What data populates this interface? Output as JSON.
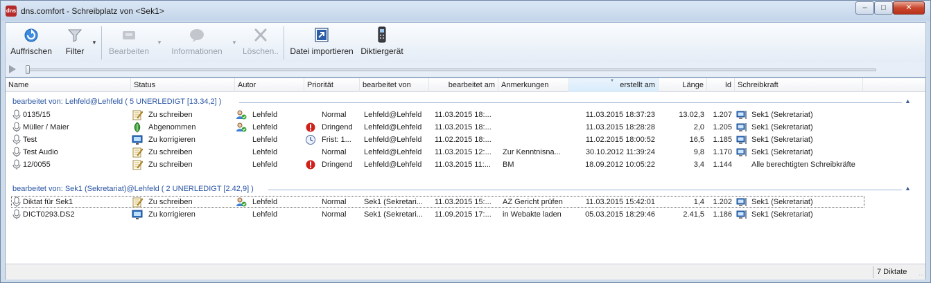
{
  "window": {
    "title": "dns.comfort - Schreibplatz von <Sek1>",
    "app_icon_text": "dns",
    "minimize": "–",
    "maximize": "□",
    "close": "✕"
  },
  "toolbar": {
    "refresh": "Auffrischen",
    "filter": "Filter",
    "edit": "Bearbeiten",
    "info": "Informationen",
    "delete": "Löschen..",
    "import": "Datei importieren",
    "recorder": "Diktiergerät",
    "dropdown_glyph": "▼"
  },
  "player": {
    "play_glyph": "▶"
  },
  "columns": {
    "name": "Name",
    "status": "Status",
    "autor": "Autor",
    "prioritaet": "Priorität",
    "bearbeitet_von": "bearbeitet von",
    "bearbeitet_am": "bearbeitet am",
    "anmerkungen": "Anmerkungen",
    "erstellt_am": "erstellt am",
    "laenge": "Länge",
    "id": "Id",
    "schreibkraft": "Schreibkraft"
  },
  "groups": [
    {
      "label": "bearbeitet von: Lehfeld@Lehfeld ( 5 UNERLEDIGT [13.34,2] )",
      "collapse_glyph": "▲",
      "rows": [
        {
          "name": "0135/15",
          "status": "Zu schreiben",
          "status_icon": "pencil-note-icon",
          "autor_icon": "user-check-icon",
          "autor": "Lehfeld",
          "prio_icon": "",
          "prioritaet": "Normal",
          "bearbeitet_von": "Lehfeld@Lehfeld",
          "bearbeitet_am": "11.03.2015 18:...",
          "anmerkungen": "",
          "erstellt_am": "11.03.2015 18:37:23",
          "laenge": "13.02,3",
          "id": "1.207",
          "schreibkraft_icon": "monitor-user-icon",
          "schreibkraft": "Sek1 (Sekretariat)"
        },
        {
          "name": "Müller / Maier",
          "status": "Abgenommen",
          "status_icon": "leaf-icon",
          "autor_icon": "user-check-icon",
          "autor": "Lehfeld",
          "prio_icon": "urgent-icon",
          "prioritaet": "Dringend",
          "bearbeitet_von": "Lehfeld@Lehfeld",
          "bearbeitet_am": "11.03.2015 18:...",
          "anmerkungen": "",
          "erstellt_am": "11.03.2015 18:28:28",
          "laenge": "2,0",
          "id": "1.205",
          "schreibkraft_icon": "monitor-user-icon",
          "schreibkraft": "Sek1 (Sekretariat)"
        },
        {
          "name": "Test",
          "status": "Zu korrigieren",
          "status_icon": "monitor-edit-icon",
          "autor_icon": "",
          "autor": "Lehfeld",
          "prio_icon": "clock-icon",
          "prioritaet": "Frist: 1...",
          "bearbeitet_von": "Lehfeld@Lehfeld",
          "bearbeitet_am": "11.02.2015 18:...",
          "anmerkungen": "",
          "erstellt_am": "11.02.2015 18:00:52",
          "laenge": "16,5",
          "id": "1.185",
          "schreibkraft_icon": "monitor-user-icon",
          "schreibkraft": "Sek1 (Sekretariat)"
        },
        {
          "name": "Test Audio",
          "status": "Zu schreiben",
          "status_icon": "pencil-note-icon",
          "autor_icon": "",
          "autor": "Lehfeld",
          "prio_icon": "",
          "prioritaet": "Normal",
          "bearbeitet_von": "Lehfeld@Lehfeld",
          "bearbeitet_am": "11.03.2015 12:...",
          "anmerkungen": "Zur Kenntnisna...",
          "erstellt_am": "30.10.2012 11:39:24",
          "laenge": "9,8",
          "id": "1.170",
          "schreibkraft_icon": "monitor-user-icon",
          "schreibkraft": "Sek1 (Sekretariat)"
        },
        {
          "name": "12/0055",
          "status": "Zu schreiben",
          "status_icon": "pencil-note-icon",
          "autor_icon": "",
          "autor": "Lehfeld",
          "prio_icon": "urgent-icon",
          "prioritaet": "Dringend",
          "bearbeitet_von": "Lehfeld@Lehfeld",
          "bearbeitet_am": "11.03.2015 11:...",
          "anmerkungen": "BM",
          "erstellt_am": "18.09.2012 10:05:22",
          "laenge": "3,4",
          "id": "1.144",
          "schreibkraft_icon": "",
          "schreibkraft": "Alle berechtigten Schreibkräfte"
        }
      ]
    },
    {
      "label": "bearbeitet von: Sek1 (Sekretariat)@Lehfeld ( 2 UNERLEDIGT [2.42,9] )",
      "collapse_glyph": "▲",
      "rows": [
        {
          "name": "Diktat für Sek1",
          "status": "Zu schreiben",
          "status_icon": "pencil-note-icon",
          "autor_icon": "user-check-icon",
          "autor": "Lehfeld",
          "prio_icon": "",
          "prioritaet": "Normal",
          "bearbeitet_von": "Sek1 (Sekretari...",
          "bearbeitet_am": "11.03.2015 15:...",
          "anmerkungen": "AZ Gericht prüfen",
          "erstellt_am": "11.03.2015 15:42:01",
          "laenge": "1,4",
          "id": "1.202",
          "schreibkraft_icon": "monitor-user-icon",
          "schreibkraft": "Sek1 (Sekretariat)",
          "focused": true
        },
        {
          "name": "DICT0293.DS2",
          "status": "Zu korrigieren",
          "status_icon": "monitor-edit-icon",
          "autor_icon": "",
          "autor": "Lehfeld",
          "prio_icon": "",
          "prioritaet": "Normal",
          "bearbeitet_von": "Sek1 (Sekretari...",
          "bearbeitet_am": "11.09.2015 17:...",
          "anmerkungen": "in Webakte laden",
          "erstellt_am": "05.03.2015 18:29:46",
          "laenge": "2.41,5",
          "id": "1.186",
          "schreibkraft_icon": "monitor-user-icon",
          "schreibkraft": "Sek1 (Sekretariat)"
        }
      ]
    }
  ],
  "status_bar": {
    "count": "7 Diktate"
  },
  "colors": {
    "group_text": "#2a55a3",
    "urgent": "#d0201a",
    "accent": "#2f6fc0"
  }
}
